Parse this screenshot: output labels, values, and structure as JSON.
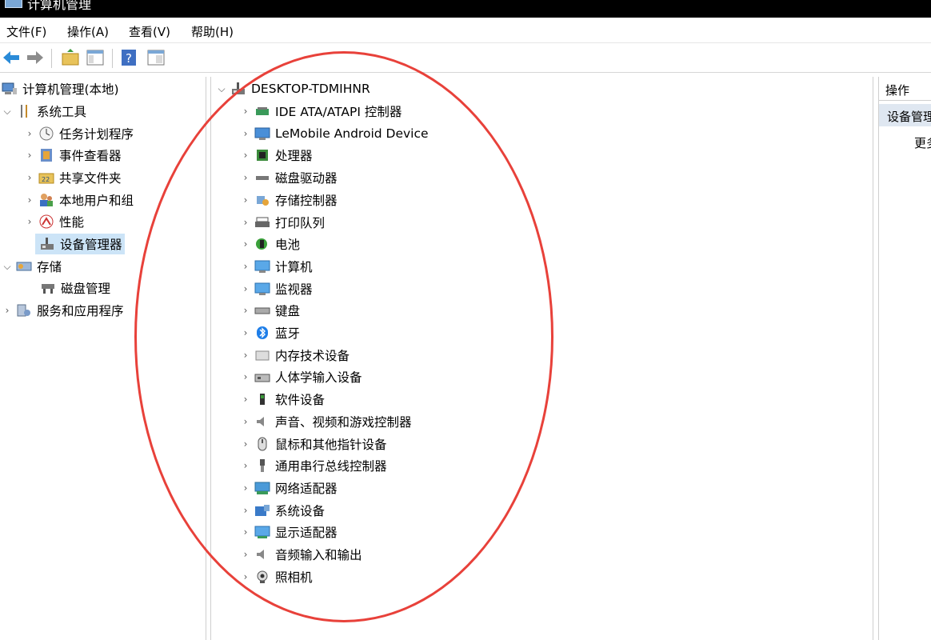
{
  "window": {
    "title": "计算机管理"
  },
  "menu": [
    "文件(F)",
    "操作(A)",
    "查看(V)",
    "帮助(H)"
  ],
  "toolbar": {
    "icons": [
      "back-arrow-icon",
      "forward-arrow-icon",
      "up-folder-icon",
      "show-hide-tree-icon",
      "help-icon",
      "properties-icon"
    ]
  },
  "tree": {
    "root": "计算机管理(本地)",
    "system_tools": "系统工具",
    "task_scheduler": "任务计划程序",
    "event_viewer": "事件查看器",
    "shared_folders": "共享文件夹",
    "local_users": "本地用户和组",
    "performance": "性能",
    "device_manager": "设备管理器",
    "storage": "存储",
    "disk_management": "磁盘管理",
    "services_apps": "服务和应用程序"
  },
  "devices": {
    "computer_name": "DESKTOP-TDMIHNR",
    "categories": [
      "IDE ATA/ATAPI 控制器",
      "LeMobile Android Device",
      "处理器",
      "磁盘驱动器",
      "存储控制器",
      "打印队列",
      "电池",
      "计算机",
      "监视器",
      "键盘",
      "蓝牙",
      "内存技术设备",
      "人体学输入设备",
      "软件设备",
      "声音、视频和游戏控制器",
      "鼠标和其他指针设备",
      "通用串行总线控制器",
      "网络适配器",
      "系统设备",
      "显示适配器",
      "音频输入和输出",
      "照相机"
    ]
  },
  "actions": {
    "header": "操作",
    "section": "设备管理器",
    "more": "更多操作"
  },
  "colors": {
    "selection": "#cce4f7",
    "annotation": "#e8413a"
  }
}
